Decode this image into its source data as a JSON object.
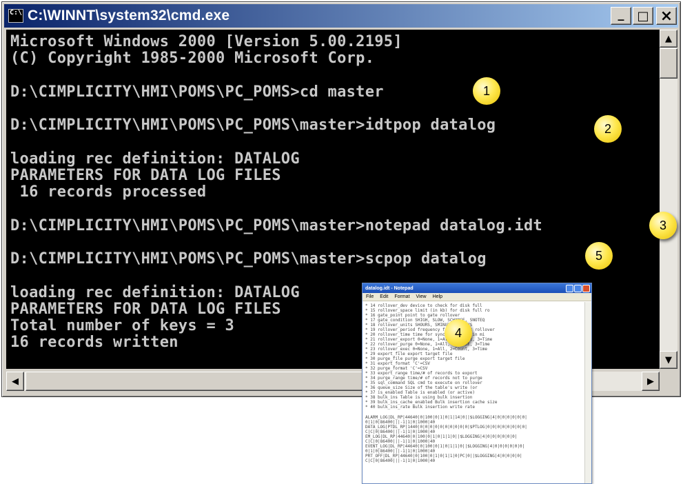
{
  "window": {
    "title": "C:\\WINNT\\system32\\cmd.exe",
    "sys_icon": "C:\\",
    "controls": {
      "minimize": "_",
      "maximize": "□",
      "close": "×"
    }
  },
  "console": {
    "lines": [
      "Microsoft Windows 2000 [Version 5.00.2195]",
      "(C) Copyright 1985-2000 Microsoft Corp.",
      "",
      "D:\\CIMPLICITY\\HMI\\POMS\\PC_POMS>cd master",
      "",
      "D:\\CIMPLICITY\\HMI\\POMS\\PC_POMS\\master>idtpop datalog",
      "",
      "loading rec definition: DATALOG",
      "PARAMETERS FOR DATA LOG FILES",
      " 16 records processed",
      "",
      "D:\\CIMPLICITY\\HMI\\POMS\\PC_POMS\\master>notepad datalog.idt",
      "",
      "D:\\CIMPLICITY\\HMI\\POMS\\PC_POMS\\master>scpop datalog",
      "",
      "loading rec definition: DATALOG",
      "PARAMETERS FOR DATA LOG FILES",
      "Total number of keys = 3",
      "16 records written"
    ]
  },
  "scrollbar": {
    "up": "▲",
    "down": "▼",
    "left": "◀",
    "right": "▶"
  },
  "callouts": [
    "1",
    "2",
    "3",
    "5",
    "4"
  ],
  "notepad": {
    "title": "datalog.idt - Notepad",
    "menu": [
      "File",
      "Edit",
      "Format",
      "View",
      "Help"
    ],
    "field_rows": [
      "*  14 rollover_dev              device to check for disk full",
      "*  15 rollover_space            limit (in kb) for disk full ro",
      "*  16 gate_point                point to gate rollover",
      "*  17 gate_condition            SHIGH, SLOW, SCHANGE, SNOTEQ",
      "*  18 rollover_units            SHOURS, SMINUTES, SDAYS",
      "*  19 rollover_period           frequency for periodic rollover",
      "*  20 rollover_time             time for synch rollover in mi",
      "*  21 rollover_export           0=None, 1=All, 2=Count, 3=Time",
      "*  22 rollover_purge            0=None, 1=All, 2=Count, 3=Time",
      "*  23 rollover_exec             0=None, 1=All, 2=Count, 3=Time",
      "*  29 export_file               export target file",
      "*  30 purge_file                purge export target file",
      "*  31 export_format             'C'=CSV",
      "*  32 purge_format              'C'=CSV",
      "*  33 export_range              time/# of records to export",
      "*  34 purge_range               time/# of records not to purge",
      "*  35 sql_command               SQL cmd to execute on rollover",
      "*  36 queue_size                Size of the table's write (or",
      "*  37 is_enabled                Table is enabled (or active)",
      "*  38 bulk_ins                  Table is using bulk insertion",
      "*  39 bulk_ins_cache_enabled    Bulk insertion cache size",
      "*  40 bulk_ins_rate             Bulk insertion write rate"
    ],
    "data_rows": [
      "ALARM_LOG|DL_RP|44640|0|100|0|1|0|1|14|0||$LOGGING|4|0|0|0|0|0|0|",
      "0|1|0|86400|||-1|1|0|1000|40",
      "DATA_LOG|PTDL_RP|1440|0|0|0|0|0|0|0|0|0|0|$PTLOG|0|0|0|0|0|0|0|0|",
      "C|C|0|86400|||-1|1|0|1000|40",
      "EM_LOG|DL_RP|44640|0|100|0|1|0|1|1|0||$LOGGING|4|0|0|0|0|0|0|",
      "C|C|0|86400|||-1|1|0|1000|40",
      "EVENT_LOG|DL_RP|44640|0|100|0|1|0|1|1|0||$LOGGING|4|0|0|0|0|0|0|",
      "0|1|0|86400|||-1|1|0|1000|40",
      "PRT_OFF|DL_RP|44640|0|100|0|1|0|1|1|0|PC|0||$LOGGING|4|0|0|0|0|",
      "C|C|0|86400|||-1|1|0|1000|40"
    ]
  }
}
